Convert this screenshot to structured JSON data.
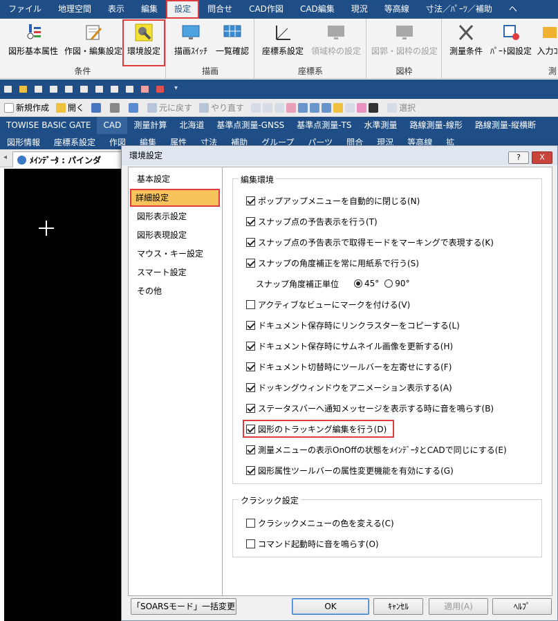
{
  "menubar": [
    "ファイル",
    "地理空間",
    "表示",
    "編集",
    "設定",
    "問合せ",
    "CAD作図",
    "CAD編集",
    "現況",
    "等高線",
    "寸法／ﾊﾟｰﾂ／補助",
    "ヘ"
  ],
  "active_menu_index": 4,
  "ribbon": {
    "groups": [
      {
        "label": "条件",
        "buttons": [
          "図形基本属性",
          "作図・編集設定",
          "環境設定"
        ]
      },
      {
        "label": "描画",
        "buttons": [
          "描画ｽｲｯﾁ",
          "一覧確認"
        ]
      },
      {
        "label": "座標系",
        "buttons": [
          "座標系設定",
          "領域枠の設定"
        ]
      },
      {
        "label": "図枠",
        "buttons": [
          "図郭・図枠の設定"
        ]
      },
      {
        "label": "測",
        "buttons": [
          "測量条件",
          "ﾊﾟｰﾄ図設定",
          "入力ｺ"
        ]
      }
    ]
  },
  "stdbar": {
    "new": "新規作成",
    "open": "開く",
    "undo": "元に戻す",
    "redo": "やり直す",
    "select": "選択"
  },
  "tabs": [
    "TOWISE BASIC GATE",
    "CAD",
    "測量計算",
    "北海道",
    "基準点測量-GNSS",
    "基準点測量-TS",
    "水準測量",
    "路線測量-線形",
    "路線測量-縦横断"
  ],
  "active_tab_index": 1,
  "menu2": [
    "図形情報",
    "座標系設定",
    "作図",
    "編集",
    "属性",
    "寸法",
    "補助",
    "グループ",
    "パーツ",
    "問合",
    "現況",
    "等高線",
    "拡"
  ],
  "doc_tab": "ﾒｲﾝﾃﾞｰﾀ : パインダ",
  "dialog": {
    "title": "環境設定",
    "help_btn": "?",
    "close_btn": "X",
    "categories": [
      "基本設定",
      "詳細設定",
      "図形表示設定",
      "図形表現設定",
      "マウス・キー設定",
      "スマート設定",
      "その他"
    ],
    "selected_category_index": 1,
    "edit_env": {
      "legend": "編集環境",
      "items": [
        {
          "label": "ポップアップメニューを自動的に閉じる(N)",
          "checked": true
        },
        {
          "label": "スナップ点の予告表示を行う(T)",
          "checked": true
        },
        {
          "label": "スナップ点の予告表示で取得モードをマーキングで表現する(K)",
          "checked": true
        },
        {
          "label": "スナップの角度補正を常に用紙系で行う(S)",
          "checked": true
        }
      ],
      "angle_unit_label": "スナップ角度補正単位",
      "radio_45": "45°",
      "radio_90": "90°",
      "angle_selected": "45°",
      "items2": [
        {
          "label": "アクティブなビューにマークを付ける(V)",
          "checked": false
        },
        {
          "label": "ドキュメント保存時にリンクラスターをコピーする(L)",
          "checked": true
        },
        {
          "label": "ドキュメント保存時にサムネイル画像を更新する(H)",
          "checked": true
        },
        {
          "label": "ドキュメント切替時にツールバーを左寄せにする(F)",
          "checked": true
        },
        {
          "label": "ドッキングウィンドウをアニメーション表示する(A)",
          "checked": true
        },
        {
          "label": "ステータスバーへ通知メッセージを表示する時に音を鳴らす(B)",
          "checked": true
        },
        {
          "label": "図形のトラッキング編集を行う(D)",
          "checked": true
        },
        {
          "label": "測量メニューの表示OnOffの状態をﾒｲﾝﾃﾞｰﾀとCADで同じにする(E)",
          "checked": true
        },
        {
          "label": "図形属性ツールバーの属性変更機能を有効にする(G)",
          "checked": true
        }
      ]
    },
    "classic": {
      "legend": "クラシック設定",
      "items": [
        {
          "label": "クラシックメニューの色を変える(C)",
          "checked": false
        },
        {
          "label": "コマンド起動時に音を鳴らす(O)",
          "checked": false
        }
      ]
    },
    "buttons": {
      "soars": "「SOARSモード」一括変更",
      "ok": "OK",
      "cancel": "ｷｬﾝｾﾙ",
      "apply": "適用(A)",
      "help": "ﾍﾙﾌﾟ"
    }
  }
}
